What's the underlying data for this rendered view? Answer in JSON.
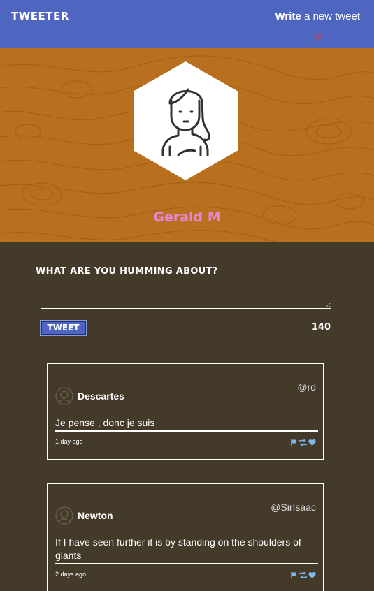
{
  "nav": {
    "brand": "TWEETER",
    "compose_bold": "Write",
    "compose_rest": " a new tweet",
    "compose_toggle_icon": "double-chevron-down-icon",
    "toggle_color": "#c0425c"
  },
  "profile": {
    "name": "Gerald M",
    "avatar_icon": "person-avatar-icon",
    "name_color": "#e686d6",
    "header_color": "#b86f1e"
  },
  "compose": {
    "title": "What are you humming about?",
    "textarea_value": "",
    "button_label": "Tweet",
    "counter": "140"
  },
  "tweets": [
    {
      "author": "Descartes",
      "handle": "@rd",
      "content": "Je pense , donc je suis",
      "time": "1 day ago",
      "action_icons": [
        "flag-icon",
        "retweet-icon",
        "heart-icon"
      ]
    },
    {
      "author": "Newton",
      "handle": "@SirIsaac",
      "content": "If I have seen further it is by standing on the shoulders of giants",
      "time": "2 days ago",
      "action_icons": [
        "flag-icon",
        "retweet-icon",
        "heart-icon"
      ]
    }
  ],
  "colors": {
    "nav": "#4e66bf",
    "background": "#433a29",
    "action_icons": "#7fb8f0"
  }
}
